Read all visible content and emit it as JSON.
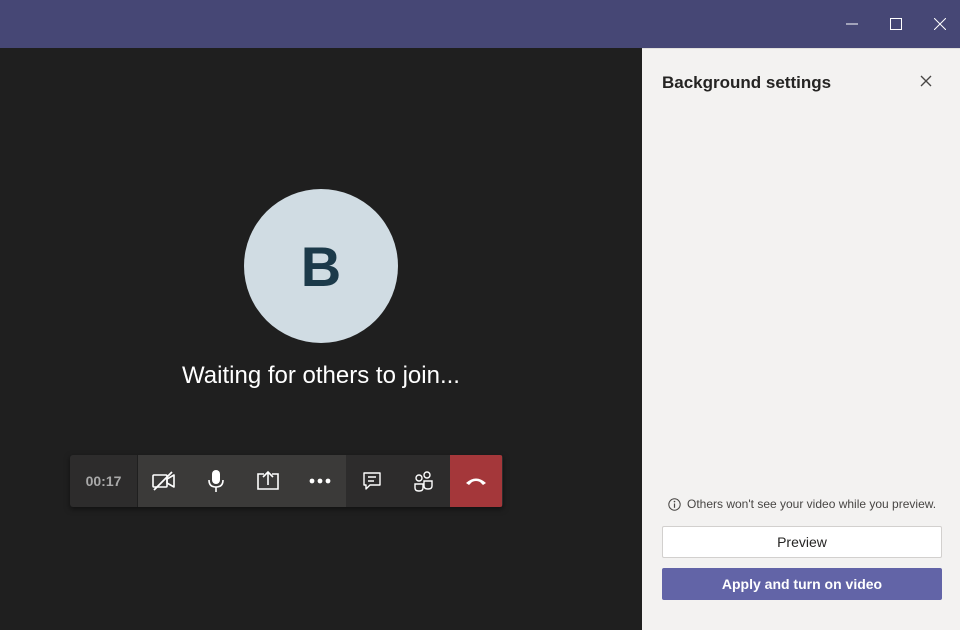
{
  "window": {
    "controls": [
      {
        "name": "minimize",
        "icon": "minimize-icon"
      },
      {
        "name": "maximize",
        "icon": "maximize-icon"
      },
      {
        "name": "close",
        "icon": "close-icon"
      }
    ]
  },
  "stage": {
    "avatar_initial": "B",
    "waiting_text": "Waiting for others to join..."
  },
  "call_bar": {
    "timer": "00:17",
    "buttons": [
      {
        "name": "camera-off",
        "icon": "video-off-icon"
      },
      {
        "name": "microphone",
        "icon": "microphone-icon"
      },
      {
        "name": "share-screen",
        "icon": "share-icon"
      },
      {
        "name": "more-actions",
        "icon": "more-icon"
      },
      {
        "name": "chat",
        "icon": "chat-icon"
      },
      {
        "name": "participants",
        "icon": "participants-icon"
      },
      {
        "name": "hang-up",
        "icon": "phone-hangup-icon"
      }
    ]
  },
  "panel": {
    "title": "Background settings",
    "notice": "Others won't see your video while you preview.",
    "preview_label": "Preview",
    "apply_label": "Apply and turn on video"
  },
  "colors": {
    "titlebar": "#464775",
    "accent": "#6264a7",
    "hangup": "#a4373a",
    "stage_bg": "#1f1f1f",
    "panel_bg": "#f3f2f1"
  }
}
